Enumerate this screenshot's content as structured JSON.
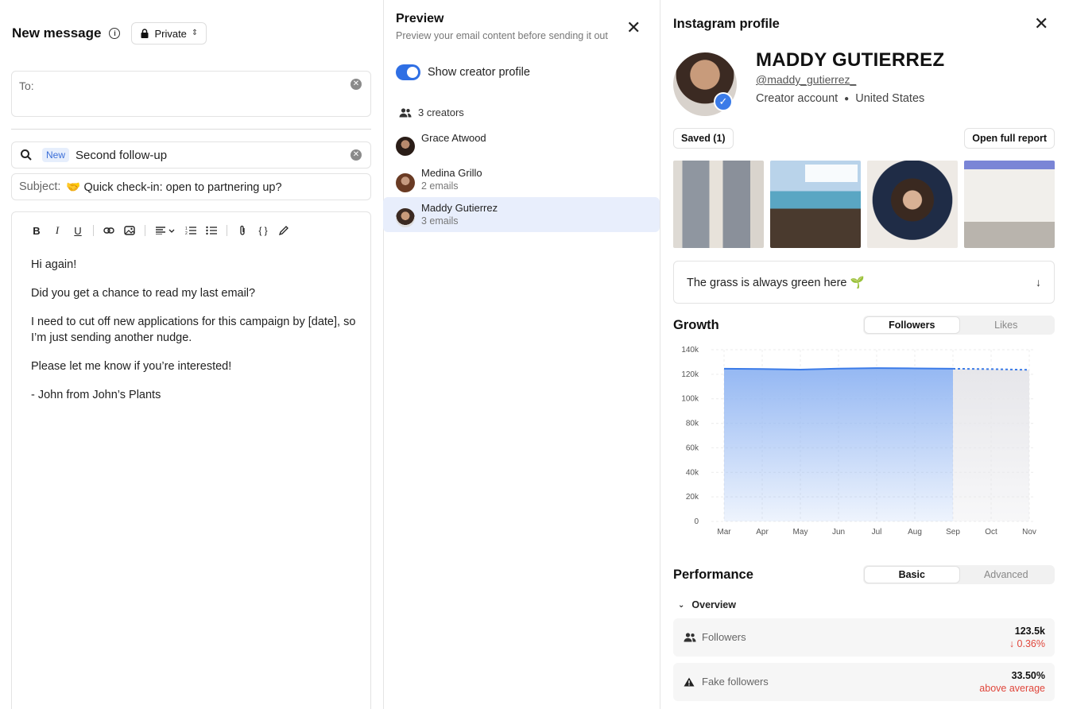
{
  "composer": {
    "title": "New message",
    "privacy": "Private",
    "to_label": "To:",
    "template_badge": "New",
    "template_name": "Second follow-up",
    "subject_label": "Subject:",
    "subject_value": "🤝 Quick check-in: open to partnering up?",
    "body": [
      "Hi again!",
      "Did you get a chance to read my last email?",
      "I need to cut off new applications for this campaign by [date], so I’m just sending another nudge.",
      "Please let me know if you’re interested!",
      "- John from John’s Plants"
    ]
  },
  "preview": {
    "title": "Preview",
    "subtitle": "Preview your email content before sending it out",
    "toggle_label": "Show creator profile",
    "creators_count": "3 creators",
    "creators": [
      {
        "name": "Grace Atwood",
        "emails": ""
      },
      {
        "name": "Medina Grillo",
        "emails": "2 emails"
      },
      {
        "name": "Maddy Gutierrez",
        "emails": "3 emails"
      }
    ]
  },
  "profile": {
    "title": "Instagram profile",
    "name": "MADDY GUTIERREZ",
    "handle": "@maddy_gutierrez_",
    "account_type": "Creator account",
    "location": "United States",
    "saved_label": "Saved (1)",
    "open_report_label": "Open full report",
    "bio": "The grass is always green here 🌱",
    "growth_title": "Growth",
    "growth_tabs": [
      "Followers",
      "Likes"
    ],
    "performance_title": "Performance",
    "performance_tabs": [
      "Basic",
      "Advanced"
    ],
    "overview_label": "Overview",
    "metrics": [
      {
        "label": "Followers",
        "value": "123.5k",
        "sub": "↓ 0.36%"
      },
      {
        "label": "Fake followers",
        "value": "33.50%",
        "sub": "above average"
      }
    ]
  },
  "chart_data": {
    "type": "area",
    "categories": [
      "Mar",
      "Apr",
      "May",
      "Jun",
      "Jul",
      "Aug",
      "Sep",
      "Oct",
      "Nov"
    ],
    "series": [
      {
        "name": "",
        "values": [
          124.5,
          124.3,
          123.8,
          124.6,
          125.0,
          124.8,
          124.5,
          124.2,
          123.6
        ]
      }
    ],
    "projected_from_index": 6,
    "ylim": [
      0,
      140
    ],
    "yticks": [
      "0",
      "20k",
      "40k",
      "60k",
      "80k",
      "100k",
      "120k",
      "140k"
    ],
    "grid": true,
    "colors": {
      "line": "#3b7be8",
      "fill": "#8fb4f2",
      "projected_fill": "#e6e6ea"
    }
  }
}
